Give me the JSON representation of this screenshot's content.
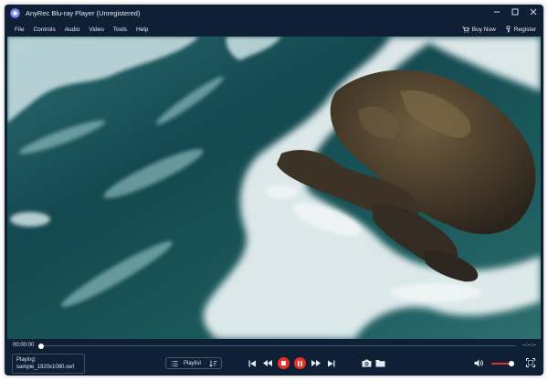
{
  "window": {
    "title": "AnyRec Blu-ray Player (Unregistered)",
    "controls": [
      "minimize-icon",
      "maximize-icon",
      "close-icon"
    ]
  },
  "menu": {
    "items": [
      {
        "label": "File"
      },
      {
        "label": "Controls"
      },
      {
        "label": "Audio"
      },
      {
        "label": "Video"
      },
      {
        "label": "Tools"
      },
      {
        "label": "Help"
      }
    ],
    "buy_now": "Buy Now",
    "register": "Register"
  },
  "playback": {
    "current_time": "00:00:00",
    "total_time": "--:--:--",
    "progress": 0.0,
    "playing_label": "Playing:",
    "file_name": "sample_1920x1080.swf",
    "playlist_label": "Playlist",
    "volume": 0.85
  },
  "colors": {
    "background": "#0f2036",
    "accent_red": "#e4322b",
    "text": "#dfe6ee"
  }
}
